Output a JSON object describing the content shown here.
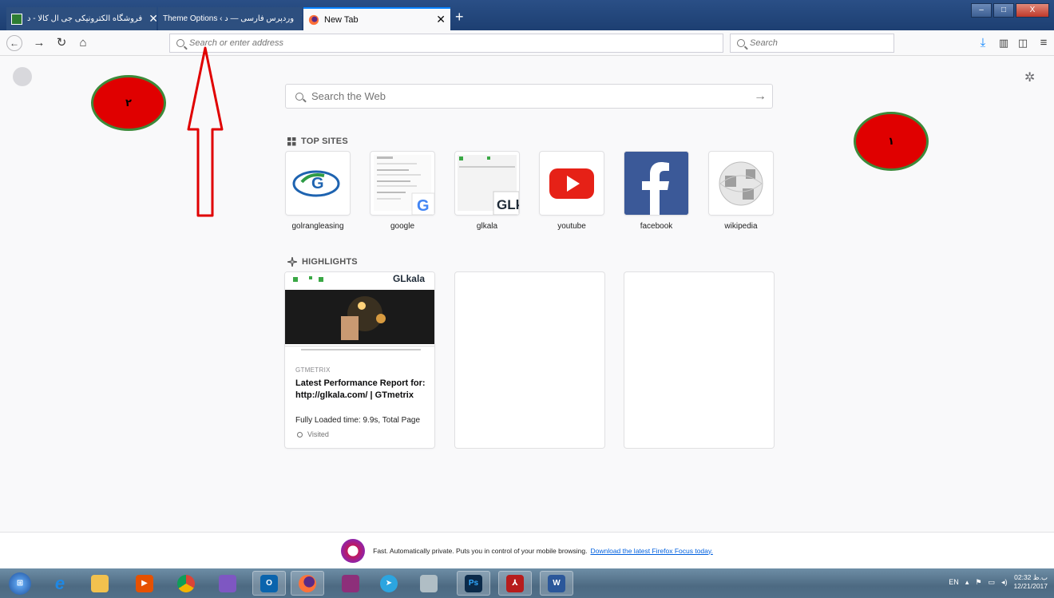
{
  "tabs": [
    {
      "title": "فروشگاه الکترونیکی جی ال کالا - د",
      "close": "✕",
      "active": false
    },
    {
      "title": "Theme Options ‹ وردپرس فارسی — د",
      "close": "✕",
      "active": false
    },
    {
      "title": "New Tab",
      "close": "✕",
      "active": true
    }
  ],
  "new_tab_label": "+",
  "window_controls": {
    "minimize": "–",
    "maximize": "□",
    "close": "X"
  },
  "navbar": {
    "address_placeholder": "Search or enter address",
    "search_placeholder": "Search"
  },
  "content": {
    "web_search_placeholder": "Search the Web",
    "top_sites_title": "TOP SITES",
    "top_sites": [
      {
        "label": "golrangleasing"
      },
      {
        "label": "google"
      },
      {
        "label": "glkala"
      },
      {
        "label": "youtube"
      },
      {
        "label": "facebook"
      },
      {
        "label": "wikipedia"
      }
    ],
    "highlights_title": "HIGHLIGHTS",
    "highlight": {
      "source": "GTMETRIX",
      "title": "Latest Performance Report for: http://glkala.com/ | GTmetrix",
      "description": "Fully Loaded time: 9.9s, Total Page",
      "status": "Visited",
      "thumb_brand": "GLkala"
    }
  },
  "annotations": {
    "badge_1": "۱",
    "badge_2": "۲"
  },
  "focus_bar": {
    "text": "Fast. Automatically private. Puts you in control of your mobile browsing.",
    "link": "Download the latest Firefox Focus today."
  },
  "taskbar": {
    "language": "EN",
    "time": "02:32 ب.ظ",
    "date": "12/21/2017"
  },
  "colors": {
    "tabstrip": "#1d3f72",
    "accent": "#0a84ff",
    "badge_fill": "#e00000",
    "badge_border": "#3d8a3a",
    "arrow": "#e00000"
  }
}
